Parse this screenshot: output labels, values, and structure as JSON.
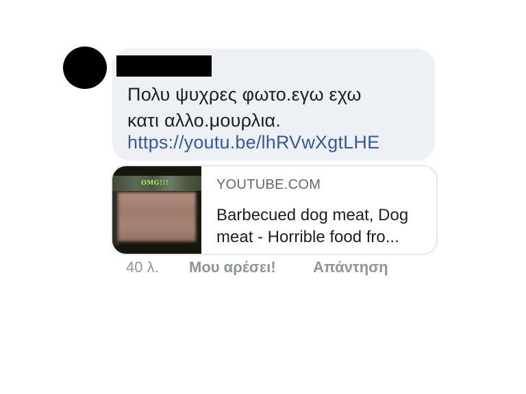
{
  "comment": {
    "author_name": "",
    "text_line1": "Πολυ ψυχρες φωτο.εγω εχω",
    "text_line2": "κατι αλλο.μουρλια.",
    "link_text": "https://youtu.be/lhRVwXgtLHE"
  },
  "link_preview": {
    "thumbnail_caption": "OMG!!!",
    "domain": "YOUTUBE.COM",
    "title": "Barbecued dog meat, Dog meat - Horrible food fro..."
  },
  "actions": {
    "timestamp": "40 λ.",
    "like_label": "Μου αρέσει!",
    "reply_label": "Απάντηση"
  },
  "colors": {
    "bubble_background": "#edf0f4",
    "link": "#385898",
    "text": "#1c1e21",
    "meta": "#8d949e",
    "redaction": "#000000"
  }
}
